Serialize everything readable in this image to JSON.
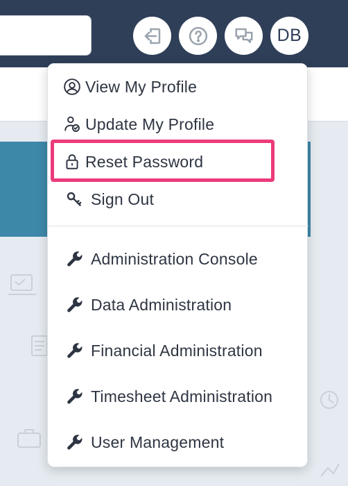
{
  "header": {
    "avatar_initials": "DB",
    "icons": [
      "sign-in-icon",
      "help-icon",
      "chat-icon"
    ]
  },
  "menu": {
    "profile_items": [
      {
        "label": "View My Profile",
        "icon": "user-circle-icon"
      },
      {
        "label": "Update My Profile",
        "icon": "user-edit-icon"
      },
      {
        "label": "Reset Password",
        "icon": "lock-icon"
      },
      {
        "label": "Sign Out",
        "icon": "key-icon"
      }
    ],
    "admin_items": [
      {
        "label": "Administration Console",
        "icon": "wrench-icon"
      },
      {
        "label": "Data Administration",
        "icon": "wrench-icon"
      },
      {
        "label": "Financial Administration",
        "icon": "wrench-icon"
      },
      {
        "label": "Timesheet Administration",
        "icon": "wrench-icon"
      },
      {
        "label": "User Management",
        "icon": "wrench-icon"
      }
    ]
  },
  "colors": {
    "topbar": "#2f3f58",
    "banner": "#3d88a9",
    "highlight": "#ec3b7a"
  }
}
